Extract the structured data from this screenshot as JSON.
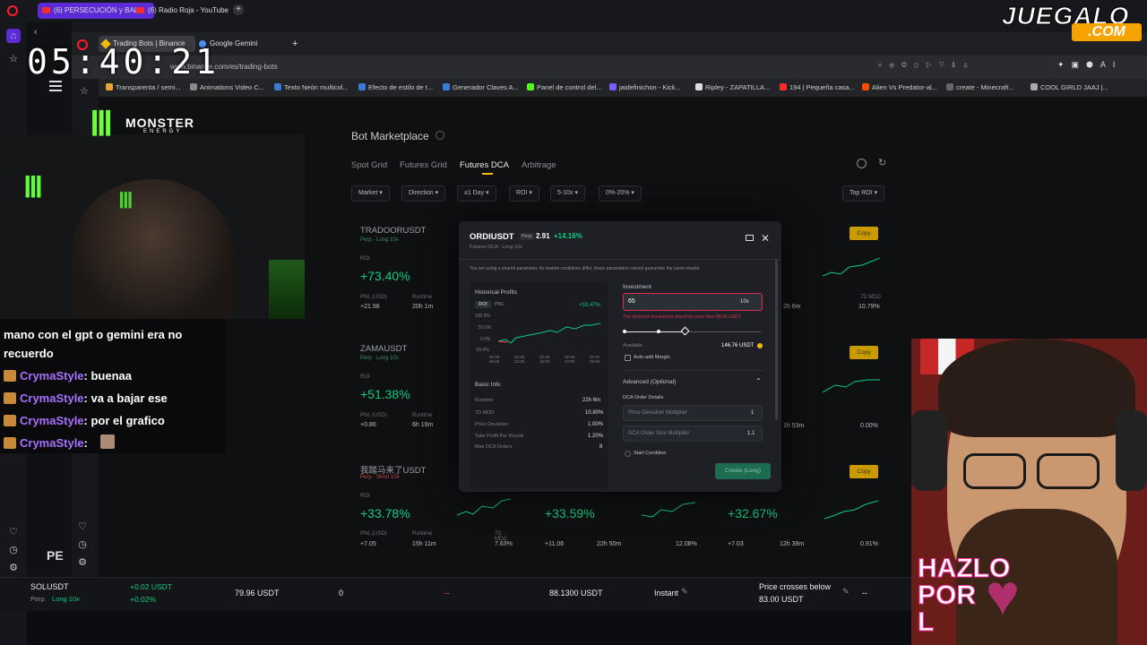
{
  "outer_tabs": [
    {
      "title": "(6) PERSECUCIÓN y BALA"
    },
    {
      "title": "(6) Radio Roja - YouTube"
    }
  ],
  "clock": "05:40:21",
  "inner_tabs": [
    {
      "title": "Trading Bots | Binance"
    },
    {
      "title": "Google Gemini"
    }
  ],
  "url": "www.binance.com/es/trading-bots",
  "bookmarks": [
    "Transparenta / semi...",
    "Animations Video C...",
    "Texto Neón multicol...",
    "Efecto de estilo de t...",
    "Generador Claves A...",
    "Panel de control del...",
    "jaidefinichon - Kick...",
    "Ripley - ZAPATILLA...",
    "194 | Pequeña casa...",
    "Alien Vs Predator-al...",
    "create - Minecraft...",
    "COOL GIRLD JAAJ |..."
  ],
  "monster": {
    "brand": "MONSTER",
    "sub": "ENERGY"
  },
  "page": {
    "title": "Bot Marketplace",
    "tabs": [
      "Spot Grid",
      "Futures Grid",
      "Futures DCA",
      "Arbitrage"
    ],
    "active_tab": "Futures DCA",
    "filters": [
      "Market",
      "Direction",
      "≤1 Day",
      "ROI",
      "5-10x",
      "0%-20%"
    ],
    "sort": "Top ROI"
  },
  "cards": [
    {
      "name": "TRADOORUSDT",
      "sub": "Perp · Long 10x",
      "roi_label": "ROI",
      "roi": "+73.40%",
      "pnl_label": "PNL (USD)",
      "pnl": "+21.98",
      "runtime_label": "Runtime",
      "runtime": "20h 1m"
    },
    {
      "name": "ZAMAUSDT",
      "sub": "Perp · Long 10x",
      "roi_label": "ROI",
      "roi": "+51.38%",
      "pnl_label": "PNL (USD)",
      "pnl": "+0.86",
      "runtime_label": "Runtime",
      "runtime": "6h 19m"
    },
    {
      "name": "我踏马来了USDT",
      "sub": "Perp · Short 10x",
      "roi_label": "ROI",
      "roi": "+33.78%",
      "pnl_label": "PNL (USD)",
      "pnl": "+7.05",
      "runtime_label": "Runtime",
      "runtime": "15h 11m",
      "mdd_label": "7D MDD",
      "mdd": "7.63%"
    },
    {
      "roi": "+33.59%",
      "pnl": "+11.06",
      "runtime": "22h 50m",
      "mdd": "12.08%"
    },
    {
      "roi": "+32.67%",
      "pnl": "+7.03",
      "runtime": "12h 39m",
      "mdd": "0.91%"
    },
    {
      "runtime": "2h 6m",
      "mdd_label": "7D MDD",
      "mdd": "10.79%"
    },
    {
      "runtime": "1h 53m",
      "mdd": "0.00%"
    }
  ],
  "copy_label": "Copy",
  "modal": {
    "pair": "ORDIUSDT",
    "perp": "Perp",
    "price": "2.91",
    "change": "+14.16%",
    "sub": "Futures DCA · Long 10x",
    "notice": "You are using a shared parameter. As market conditions differ, these parameters cannot guarantee the same results.",
    "hist_title": "Historical Profits",
    "roi_tab": "ROI",
    "pnl_tab": "PNL",
    "hist_value": "+53.47%",
    "y_ticks": [
      "100.0%",
      "50.0%",
      "0.0%",
      "-50.0%"
    ],
    "x_ticks": [
      "02-05 06:00",
      "02-05 12:00",
      "02-06 18:00",
      "02-06 23:00",
      "02-07 05:00"
    ],
    "basic_info": "Basic Info",
    "info_rows": [
      {
        "k": "Runtime",
        "v": "22h 6m"
      },
      {
        "k": "7D MDD",
        "v": "10.80%"
      },
      {
        "k": "Price Deviation",
        "v": "1.00%"
      },
      {
        "k": "Take Profit Per Round",
        "v": "1.20%"
      },
      {
        "k": "Max DCA Orders",
        "v": "8"
      }
    ],
    "investment_label": "Investment",
    "investment_value": "65",
    "leverage": "10x",
    "error": "The minimum investment should be more than 88.66 USDT",
    "available_label": "Available",
    "available_value": "146.76 USDT",
    "auto_margin": "Auto-add Margin",
    "advanced": "Advanced (Optional)",
    "dca_details": "DCA Order Details",
    "price_dev_mult": "Price Deviation Multiplier",
    "price_dev_mult_val": "1",
    "dca_size_mult": "DCA Order Size Multiplier",
    "dca_size_mult_val": "1.1",
    "start_condition": "Start Condition",
    "create": "Create (Long)"
  },
  "chat": [
    {
      "user": "",
      "text": "mano con el gpt o gemini era no"
    },
    {
      "user": "",
      "text": "recuerdo"
    },
    {
      "user": "CrymaStyle",
      "text": ": buenaa"
    },
    {
      "user": "CrymaStyle",
      "text": ": va a bajar ese"
    },
    {
      "user": "CrymaStyle",
      "text": ": por el grafico"
    },
    {
      "user": "CrymaStyle",
      "text": ":"
    }
  ],
  "bottom": {
    "pair": "SOLUSDT",
    "sub": "Perp",
    "mode": "Long 10x",
    "pnl": "+0.02 USDT",
    "pnl_pct": "+0.02%",
    "investment": "79.96 USDT",
    "zero": "0",
    "dash": "--",
    "price": "88.1300 USDT",
    "trigger": "Instant",
    "cond1": "Price crosses below",
    "cond2": "83.00 USDT",
    "end": "--"
  },
  "juegalo": {
    "top": "JUEGALO",
    "bottom": ".COM"
  },
  "hazlo": {
    "l1": "HAZLO",
    "l2": "POR",
    "l3": "L"
  },
  "pe_text": "PE"
}
